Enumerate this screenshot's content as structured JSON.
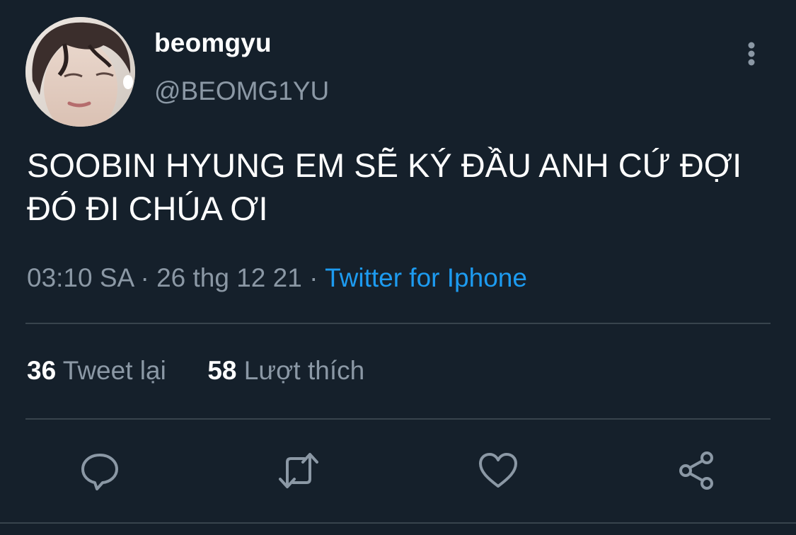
{
  "user": {
    "display_name": "beomgyu",
    "handle": "@BEOMG1YU",
    "avatar": "profile-photo"
  },
  "tweet": {
    "text": "SOOBIN HYUNG EM SẼ KÝ ĐẦU ANH CỨ ĐỢI ĐÓ ĐI CHÚA ƠI",
    "time": "03:10 SA",
    "date": "26 thg 12 21",
    "separator": "·",
    "source": "Twitter for Iphone"
  },
  "stats": {
    "retweets_count": "36",
    "retweets_label": "Tweet lại",
    "likes_count": "58",
    "likes_label": "Lượt thích"
  },
  "actions": [
    {
      "icon": "reply-icon"
    },
    {
      "icon": "retweet-icon"
    },
    {
      "icon": "like-icon"
    },
    {
      "icon": "share-icon"
    }
  ],
  "colors": {
    "background": "#15202b",
    "text": "#ffffff",
    "secondary": "#8b98a5",
    "accent": "#1d9bf0",
    "divider": "#38444d"
  }
}
